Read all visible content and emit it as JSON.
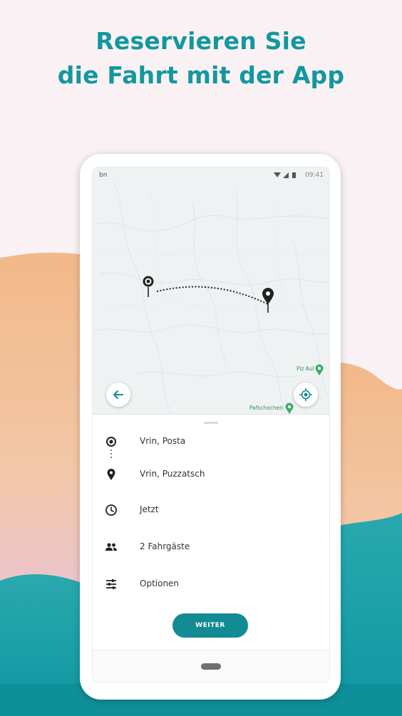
{
  "headline": {
    "line1": "Reservieren Sie",
    "line2": "die Fahrt mit der App"
  },
  "status_bar": {
    "app_badge": "bn",
    "time": "09:41"
  },
  "map": {
    "labels": [
      "Piz Aul",
      "Pafschochen"
    ]
  },
  "trip": {
    "origin": "Vrin, Posta",
    "destination": "Vrin, Puzzatsch",
    "time": "Jetzt",
    "passengers": "2 Fahrgäste",
    "options": "Optionen"
  },
  "actions": {
    "continue_label": "WEITER"
  },
  "colors": {
    "accent": "#13979f",
    "button": "#138b94",
    "background": "#f9f1f3",
    "sand": "#f2b98a",
    "teal_wave": "#1aa0aa"
  },
  "icons": {
    "back": "arrow-left-icon",
    "locate": "my-location-icon",
    "origin": "radio-target-icon",
    "destination": "map-pin-icon",
    "time": "clock-icon",
    "passengers": "people-icon",
    "options": "sliders-icon"
  }
}
